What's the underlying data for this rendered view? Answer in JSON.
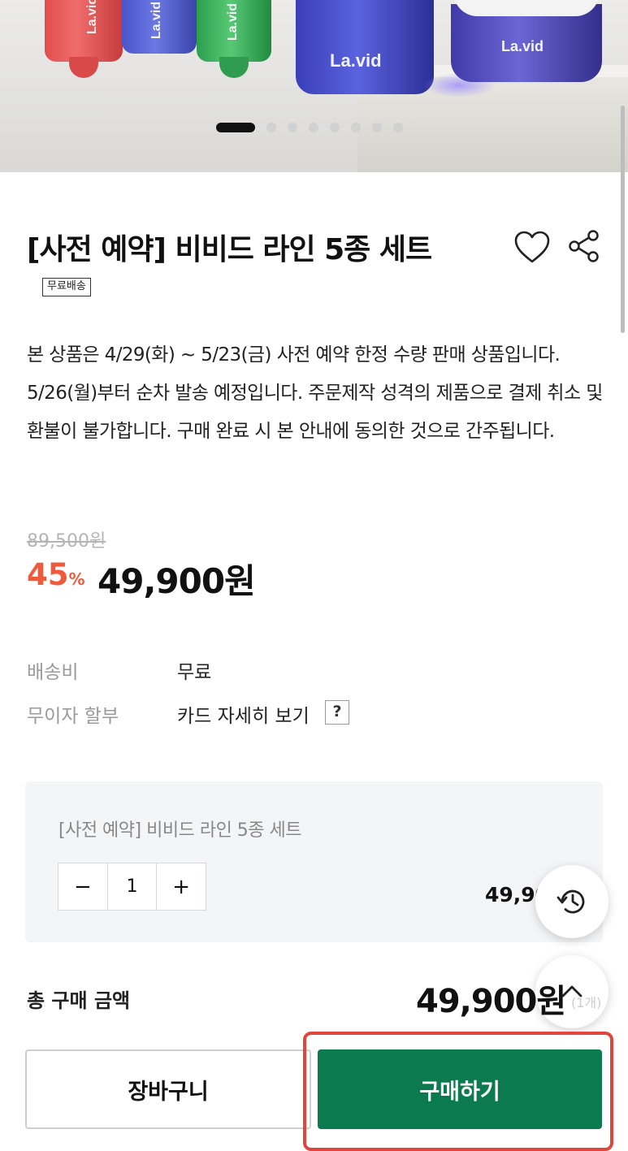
{
  "hero": {
    "brand_text": "La.vid",
    "slide_count": 9,
    "active_slide": 1
  },
  "product": {
    "title": "[사전 예약] 비비드 라인 5종 세트",
    "badge": "무료배송",
    "description": "본 상품은 4/29(화) ~ 5/23(금) 사전 예약 한정 수량 판매 상품입니다. 5/26(월)부터 순차 발송 예정입니다. 주문제작 성격의 제품으로 결제 취소 및 환불이 불가합니다. 구매 완료 시 본 안내에 동의한 것으로 간주됩니다.",
    "original_price": "89,500원",
    "discount_value": "45",
    "discount_unit": "%",
    "sale_price": "49,900원"
  },
  "info": {
    "shipping_label": "배송비",
    "shipping_value": "무료",
    "installment_label": "무이자 할부",
    "installment_value": "카드 자세히 보기",
    "help_mark": "?"
  },
  "option": {
    "name": "[사전 예약] 비비드 라인 5종 세트",
    "minus": "−",
    "quantity": "1",
    "plus": "+",
    "price": "49,900원"
  },
  "total": {
    "label": "총 구매 금액",
    "price": "49,900원",
    "unit": "(1개)"
  },
  "actions": {
    "cart": "장바구니",
    "buy": "구매하기"
  },
  "colors": {
    "discount": "#f05a3c",
    "buy_button": "#0b7a4e",
    "highlight": "#e0463d"
  }
}
